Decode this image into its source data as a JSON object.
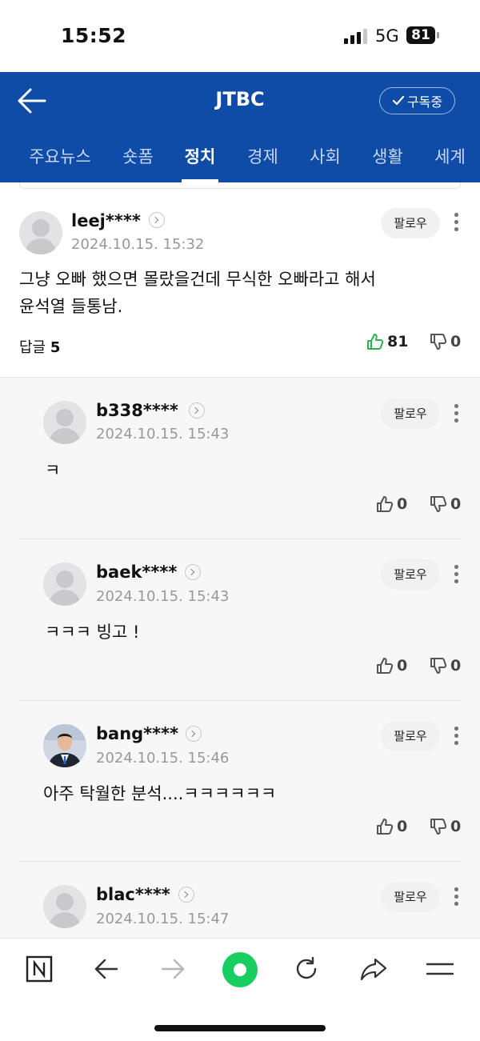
{
  "status": {
    "time": "15:52",
    "network": "5G",
    "battery": "81"
  },
  "header": {
    "title": "JTBC",
    "subscribe_label": "구독중"
  },
  "tabs": [
    {
      "label": "주요뉴스"
    },
    {
      "label": "숏폼"
    },
    {
      "label": "정치",
      "active": true
    },
    {
      "label": "경제"
    },
    {
      "label": "사회"
    },
    {
      "label": "생활"
    },
    {
      "label": "세계"
    }
  ],
  "main_comment": {
    "user": "leej****",
    "date": "2024.10.15. 15:32",
    "follow_label": "팔로우",
    "text_line1": "그냥 오빠 했으면 몰랐을건데 무식한 오빠라고 해서",
    "text_line2": "윤석열 들통남.",
    "replies_label": "답글",
    "replies_count": "5",
    "likes": "81",
    "dislikes": "0"
  },
  "replies": [
    {
      "user": "b338****",
      "date": "2024.10.15. 15:43",
      "follow_label": "팔로우",
      "text": "ㅋ",
      "likes": "0",
      "dislikes": "0"
    },
    {
      "user": "baek****",
      "date": "2024.10.15. 15:43",
      "follow_label": "팔로우",
      "text": "ㅋㅋㅋ 빙고 !",
      "likes": "0",
      "dislikes": "0"
    },
    {
      "user": "bang****",
      "date": "2024.10.15. 15:46",
      "follow_label": "팔로우",
      "text": "아주 탁월한 분석....ㅋㅋㅋㅋㅋㅋ",
      "likes": "0",
      "dislikes": "0"
    },
    {
      "user": "blac****",
      "date": "2024.10.15. 15:47",
      "follow_label": "팔로우"
    }
  ],
  "colors": {
    "brand_blue": "#0f4ca8",
    "like_green": "#2bb24c"
  },
  "bottom_bar": {
    "icons": [
      "naver-n-icon",
      "back-arrow-icon",
      "forward-arrow-icon",
      "green-dot-home-icon",
      "refresh-icon",
      "share-icon",
      "menu-icon"
    ]
  }
}
